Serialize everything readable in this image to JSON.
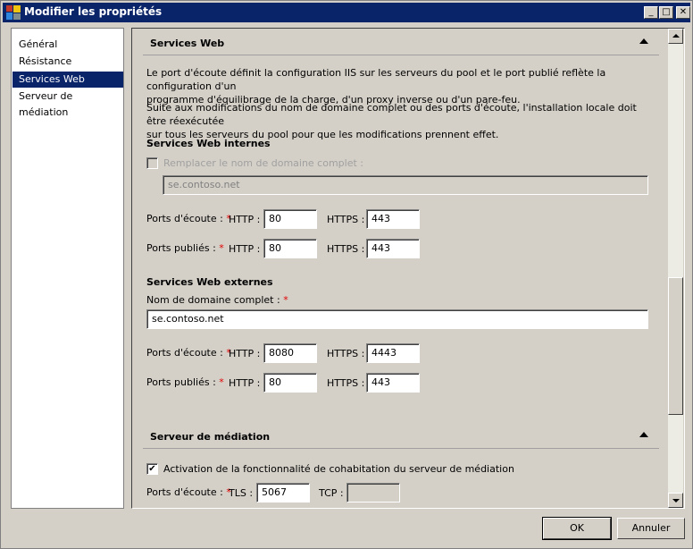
{
  "window": {
    "title": "Modifier les propriétés",
    "controls": {
      "minimize": "_",
      "maximize": "□",
      "close": "✕"
    }
  },
  "sidebar": {
    "items": [
      {
        "label": "Général",
        "active": false
      },
      {
        "label": "Résistance",
        "active": false
      },
      {
        "label": "Services Web",
        "active": true
      },
      {
        "label": "Serveur de médiation",
        "active": false
      }
    ]
  },
  "web_services": {
    "title": "Services Web",
    "para1_line1": "Le port d'écoute définit la configuration IIS sur les serveurs du pool et le port publié reflète la configuration d'un",
    "para1_line2": "programme d'équilibrage de la charge, d'un proxy inverse ou d'un pare-feu.",
    "para2_line1": "Suite aux modifications du nom de domaine complet ou des ports d'écoute, l'installation locale doit être réexécutée",
    "para2_line2": "sur tous les serveurs du pool pour que les modifications prennent effet.",
    "internal": {
      "title": "Services Web internes",
      "override_fqdn_label": "Remplacer le nom de domaine complet :",
      "override_fqdn_checked": false,
      "fqdn_value": "se.contoso.net",
      "listen_label": "Ports d'écoute :",
      "published_label": "Ports publiés :",
      "required": "*",
      "http_label": "HTTP :",
      "https_label": "HTTPS :",
      "listen_http": "80",
      "listen_https": "443",
      "published_http": "80",
      "published_https": "443"
    },
    "external": {
      "title": "Services Web externes",
      "fqdn_label": "Nom de domaine complet :",
      "fqdn_value": "se.contoso.net",
      "listen_label": "Ports d'écoute :",
      "published_label": "Ports publiés :",
      "required": "*",
      "http_label": "HTTP :",
      "https_label": "HTTPS :",
      "listen_http": "8080",
      "listen_https": "4443",
      "published_http": "80",
      "published_https": "443"
    }
  },
  "mediation": {
    "title": "Serveur de médiation",
    "collocation_label": "Activation de la fonctionnalité de cohabitation du serveur de médiation",
    "collocation_checked": true,
    "listen_label": "Ports d'écoute :",
    "required": "*",
    "tls_label": "TLS :",
    "tls_value": "5067",
    "tcp_label": "TCP :",
    "tcp_value": ""
  },
  "buttons": {
    "ok": "OK",
    "cancel": "Annuler"
  },
  "check_mark": "✔"
}
